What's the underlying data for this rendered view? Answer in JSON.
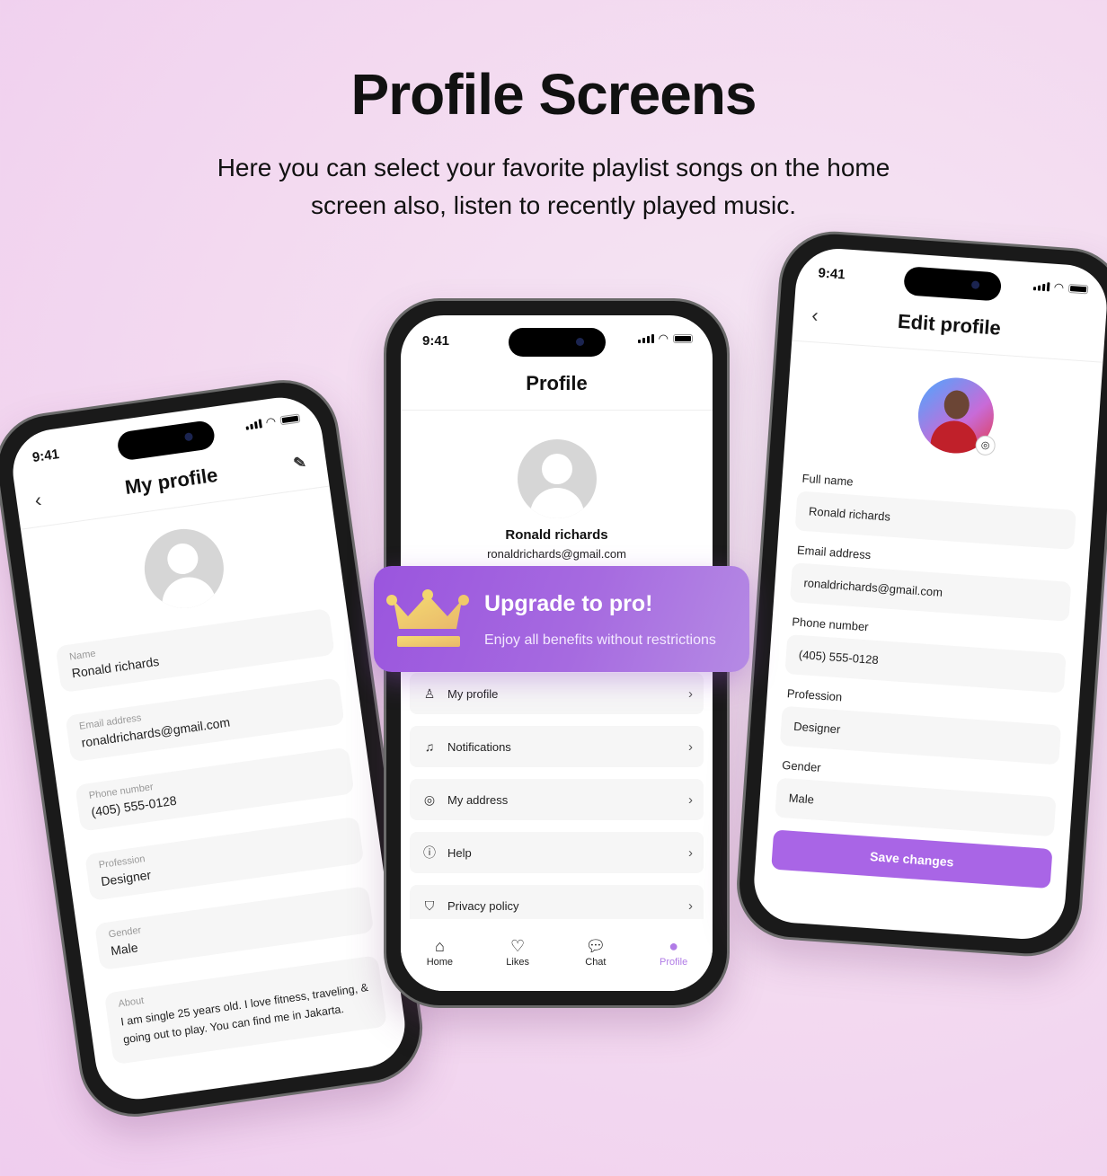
{
  "page": {
    "title": "Profile Screens",
    "subtitle": "Here you can select your favorite playlist songs on the home screen also, listen to recently played music."
  },
  "status": {
    "time": "9:41"
  },
  "my_profile": {
    "title": "My profile",
    "fields": [
      {
        "label": "Name",
        "value": "Ronald richards"
      },
      {
        "label": "Email address",
        "value": "ronaldrichards@gmail.com"
      },
      {
        "label": "Phone number",
        "value": "(405) 555-0128"
      },
      {
        "label": "Profession",
        "value": "Designer"
      },
      {
        "label": "Gender",
        "value": "Male"
      },
      {
        "label": "About",
        "value": "I am single 25 years old. I love fitness, traveling, & going out to play. You can find me in Jakarta."
      }
    ]
  },
  "profile": {
    "title": "Profile",
    "name": "Ronald richards",
    "email": "ronaldrichards@gmail.com",
    "menu": [
      {
        "label": "My profile",
        "icon": "user-icon"
      },
      {
        "label": "Notifications",
        "icon": "bell-icon"
      },
      {
        "label": "My address",
        "icon": "location-icon"
      },
      {
        "label": "Help",
        "icon": "info-icon"
      },
      {
        "label": "Privacy policy",
        "icon": "shield-icon"
      }
    ],
    "tabs": [
      {
        "label": "Home",
        "icon": "home-icon"
      },
      {
        "label": "Likes",
        "icon": "heart-icon"
      },
      {
        "label": "Chat",
        "icon": "chat-icon"
      },
      {
        "label": "Profile",
        "icon": "user-icon",
        "active": true
      }
    ]
  },
  "banner": {
    "title": "Upgrade to pro!",
    "subtitle": "Enjoy all benefits without restrictions"
  },
  "edit_profile": {
    "title": "Edit profile",
    "fields": [
      {
        "label": "Full name",
        "value": "Ronald richards"
      },
      {
        "label": "Email address",
        "value": "ronaldrichards@gmail.com"
      },
      {
        "label": "Phone number",
        "value": "(405) 555-0128"
      },
      {
        "label": "Profession",
        "value": "Designer"
      },
      {
        "label": "Gender",
        "value": "Male"
      }
    ],
    "save_label": "Save changes"
  },
  "colors": {
    "accent": "#a965e6",
    "background": "#f3d9f0",
    "crown": "#f0c96a"
  }
}
